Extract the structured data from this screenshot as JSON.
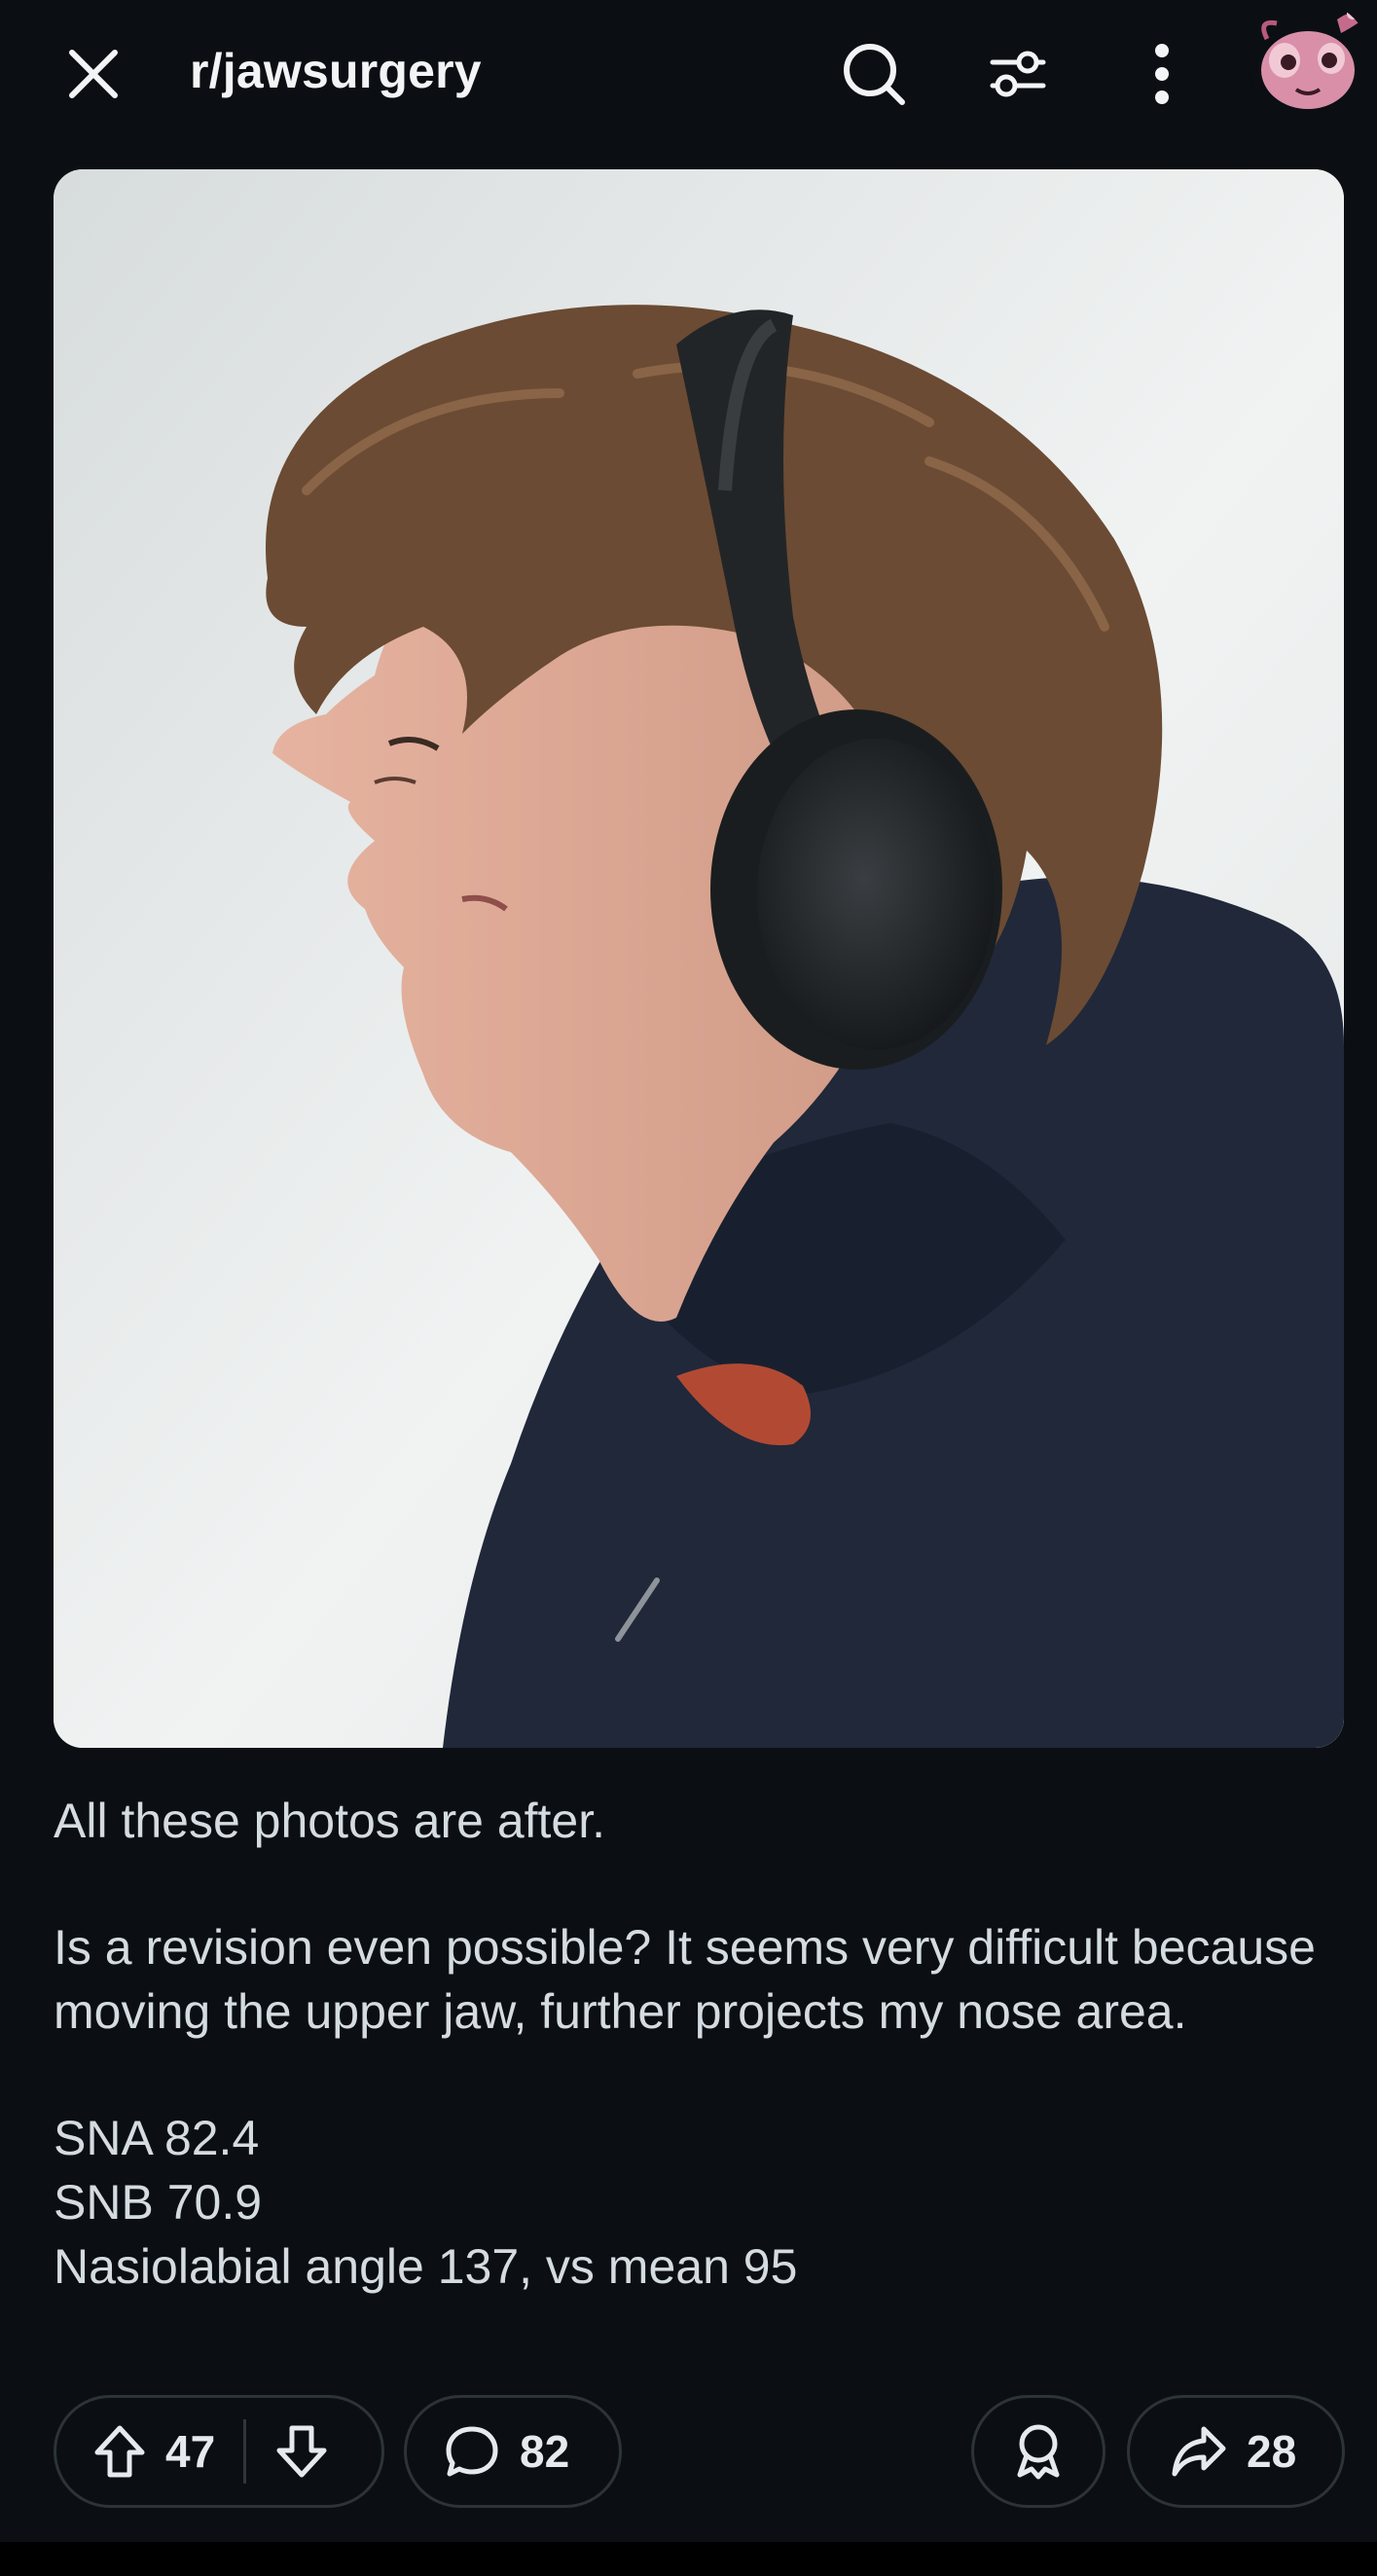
{
  "header": {
    "subreddit": "r/jawsurgery"
  },
  "post": {
    "image_alt": "Side profile photo of a man with brown hair wearing black over-ear headphones and a navy hoodie",
    "body": [
      "All these photos are after.",
      "Is a revision even possible? It seems very difficult because moving the upper jaw, further projects my nose area.",
      "SNA 82.4",
      "SNB 70.9",
      "Nasiolabial angle 137, vs mean 95"
    ]
  },
  "actions": {
    "upvotes": "47",
    "comments": "82",
    "shares": "28"
  },
  "colors": {
    "background": "#0b0f13",
    "text": "#d4dbe1",
    "pill_border": "#2c3339"
  }
}
